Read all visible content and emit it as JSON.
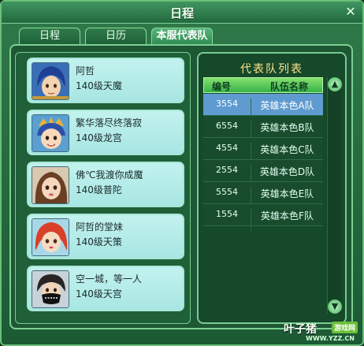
{
  "window": {
    "title": "日程",
    "close_icon": "close-icon"
  },
  "tabs": [
    {
      "label": "日程",
      "active": false
    },
    {
      "label": "日历",
      "active": false
    },
    {
      "label": "本服代表队",
      "active": true
    }
  ],
  "members": [
    {
      "name": "阿哲",
      "level": "140级天魔",
      "avatar": "avatar-blue-haired-hero"
    },
    {
      "name": "繁华落尽终落寂",
      "level": "140级龙宫",
      "avatar": "avatar-crowned-child"
    },
    {
      "name": "佛℃我渡你成魔",
      "level": "140级普陀",
      "avatar": "avatar-brown-haired-girl"
    },
    {
      "name": "阿哲的堂妹",
      "level": "140级天策",
      "avatar": "avatar-red-haired-girl"
    },
    {
      "name": "空一城，等一人",
      "level": "140级天宫",
      "avatar": "avatar-masked-boy"
    }
  ],
  "team_list": {
    "title": "代表队列表",
    "columns": [
      "编号",
      "队伍名称"
    ],
    "rows": [
      {
        "code": "3554",
        "name": "英雄本色A队",
        "selected": true
      },
      {
        "code": "6554",
        "name": "英雄本色B队",
        "selected": false
      },
      {
        "code": "4554",
        "name": "英雄本色C队",
        "selected": false
      },
      {
        "code": "2554",
        "name": "英雄本色D队",
        "selected": false
      },
      {
        "code": "5554",
        "name": "英雄本色E队",
        "selected": false
      },
      {
        "code": "1554",
        "name": "英雄本色F队",
        "selected": false
      }
    ]
  },
  "watermark": {
    "main": "叶子猪",
    "badge": "游戏网",
    "url": "WWW.YZZ.CN"
  },
  "colors": {
    "accent_green": "#37b34a",
    "selected_row": "#5f9bd0",
    "title_gold": "#ffe389"
  }
}
